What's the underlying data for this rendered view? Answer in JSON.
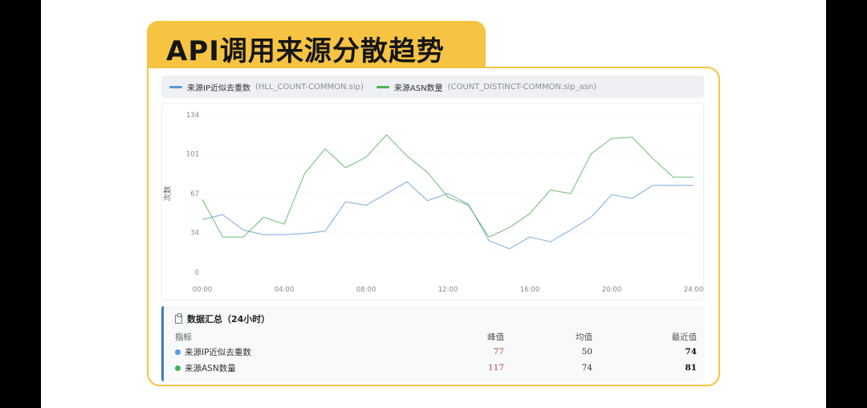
{
  "header": {
    "title": "API调用来源分散趋势"
  },
  "colors": {
    "series1": "#5b9bd5",
    "series2": "#4caf50",
    "accent": "#f6c343"
  },
  "legend": [
    {
      "label": "来源IP近似去重数",
      "sub": "(HLL_COUNT-COMMON.sip)"
    },
    {
      "label": "来源ASN数量",
      "sub": "(COUNT_DISTINCT-COMMON.sip_asn)"
    }
  ],
  "chart_data": {
    "type": "line",
    "ylabel": "次数",
    "xlabel": "",
    "ylim": [
      0,
      134
    ],
    "yticks": [
      "0",
      "34",
      "67",
      "101",
      "134"
    ],
    "yticks_values": [
      0,
      34,
      67,
      101,
      134
    ],
    "xlim": [
      0,
      24
    ],
    "xticks": [
      "00:00",
      "04:00",
      "08:00",
      "12:00",
      "16:00",
      "20:00",
      "24:00"
    ],
    "xticks_values": [
      0,
      4,
      8,
      12,
      16,
      20,
      24
    ],
    "x": [
      0,
      1,
      2,
      3,
      4,
      5,
      6,
      7,
      8,
      9,
      10,
      11,
      12,
      13,
      14,
      15,
      16,
      17,
      18,
      19,
      20,
      21,
      22,
      23,
      24
    ],
    "series": [
      {
        "name": "来源IP近似去重数",
        "values": [
          45,
          49,
          36,
          32,
          32,
          33,
          35,
          60,
          57,
          67,
          77,
          61,
          67,
          58,
          27,
          20,
          30,
          26,
          36,
          47,
          66,
          63,
          74,
          74,
          74
        ]
      },
      {
        "name": "来源ASN数量",
        "values": [
          62,
          30,
          30,
          47,
          41,
          84,
          105,
          89,
          98,
          117,
          99,
          85,
          64,
          57,
          30,
          38,
          50,
          70,
          67,
          101,
          114,
          115,
          97,
          81,
          81
        ]
      }
    ]
  },
  "summary": {
    "title": "数据汇总（24小时）",
    "headers": [
      "指标",
      "峰值",
      "均值",
      "最近值"
    ],
    "rows": [
      {
        "name": "来源IP近似去重数",
        "peak": "77",
        "avg": "50",
        "latest": "74"
      },
      {
        "name": "来源ASN数量",
        "peak": "117",
        "avg": "74",
        "latest": "81"
      }
    ]
  }
}
